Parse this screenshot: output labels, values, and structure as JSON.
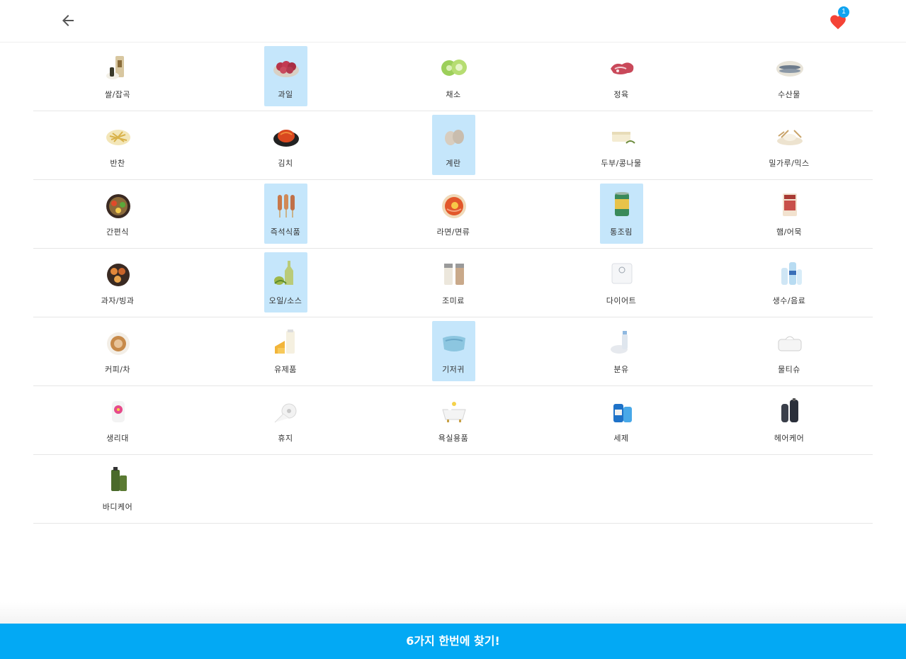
{
  "header": {
    "back_icon": "arrow-left-icon",
    "favorites_icon": "heart-icon",
    "favorites_count": "1",
    "heart_color": "#f44336",
    "badge_color": "#10a4f0"
  },
  "selection_color": "#c5e6fb",
  "categories": [
    {
      "label": "쌀/잡곡",
      "icon": "rice-grain-icon",
      "selected": false
    },
    {
      "label": "과일",
      "icon": "fruit-icon",
      "selected": true
    },
    {
      "label": "채소",
      "icon": "cabbage-icon",
      "selected": false
    },
    {
      "label": "정육",
      "icon": "meat-icon",
      "selected": false
    },
    {
      "label": "수산물",
      "icon": "fish-icon",
      "selected": false
    },
    {
      "label": "반찬",
      "icon": "side-dish-icon",
      "selected": false
    },
    {
      "label": "김치",
      "icon": "kimchi-icon",
      "selected": false
    },
    {
      "label": "계란",
      "icon": "egg-icon",
      "selected": true
    },
    {
      "label": "두부/콩나물",
      "icon": "tofu-icon",
      "selected": false
    },
    {
      "label": "밀가루/믹스",
      "icon": "flour-icon",
      "selected": false
    },
    {
      "label": "간편식",
      "icon": "meal-kit-icon",
      "selected": false
    },
    {
      "label": "즉석식품",
      "icon": "corn-dog-icon",
      "selected": true
    },
    {
      "label": "라면/면류",
      "icon": "ramen-icon",
      "selected": false
    },
    {
      "label": "통조림",
      "icon": "can-icon",
      "selected": true
    },
    {
      "label": "햄/어묵",
      "icon": "ham-icon",
      "selected": false
    },
    {
      "label": "과자/빙과",
      "icon": "snack-icon",
      "selected": false
    },
    {
      "label": "오일/소스",
      "icon": "oil-bottle-icon",
      "selected": true
    },
    {
      "label": "조미료",
      "icon": "seasoning-icon",
      "selected": false
    },
    {
      "label": "다이어트",
      "icon": "scale-icon",
      "selected": false
    },
    {
      "label": "생수/음료",
      "icon": "water-bottle-icon",
      "selected": false
    },
    {
      "label": "커피/차",
      "icon": "coffee-icon",
      "selected": false
    },
    {
      "label": "유제품",
      "icon": "dairy-icon",
      "selected": false
    },
    {
      "label": "기저귀",
      "icon": "diaper-icon",
      "selected": true
    },
    {
      "label": "분유",
      "icon": "baby-formula-icon",
      "selected": false
    },
    {
      "label": "물티슈",
      "icon": "wet-tissue-icon",
      "selected": false
    },
    {
      "label": "생리대",
      "icon": "sanitary-pad-icon",
      "selected": false
    },
    {
      "label": "휴지",
      "icon": "toilet-paper-icon",
      "selected": false
    },
    {
      "label": "욕실용품",
      "icon": "bathtub-icon",
      "selected": false
    },
    {
      "label": "세제",
      "icon": "detergent-icon",
      "selected": false
    },
    {
      "label": "헤어케어",
      "icon": "shampoo-icon",
      "selected": false
    },
    {
      "label": "바디케어",
      "icon": "body-wash-icon",
      "selected": false
    }
  ],
  "cta": {
    "label": "6가지 한번에 찾기!",
    "color": "#03a9f4"
  }
}
